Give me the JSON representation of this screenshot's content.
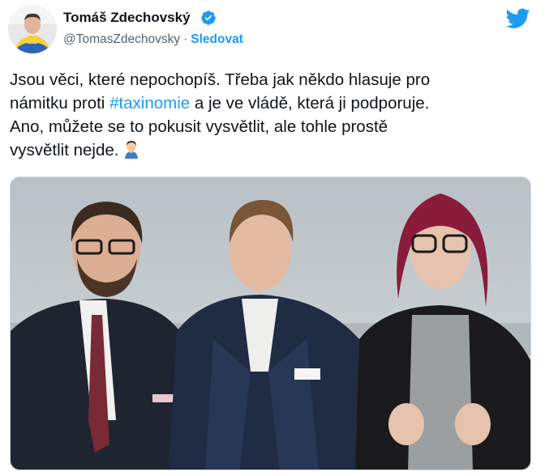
{
  "author": {
    "name": "Tomáš Zdechovský",
    "handle": "@TomasZdechovsky",
    "separator": "·",
    "follow_label": "Sledovat",
    "avatar_icon": "profile-photo",
    "verified_icon": "verified-badge-icon"
  },
  "brand": {
    "logo_icon": "twitter-bird-icon",
    "accent_color": "#1d9bf0"
  },
  "tweet": {
    "line1": "Jsou věci, které nepochopíš. Třeba jak někdo hlasuje pro",
    "line2_before": "námitku proti ",
    "hashtag": "#taxinomie",
    "line2_after": " a je ve vládě, která ji podporuje.",
    "line3": "Ano, můžete se to pokusit vysvětlit, ale tohle prostě",
    "line4": "vysvětlit nejde.",
    "emoji_icon": "face-palm-emoji-icon"
  },
  "media": {
    "photo_icon": "three-people-photo"
  }
}
